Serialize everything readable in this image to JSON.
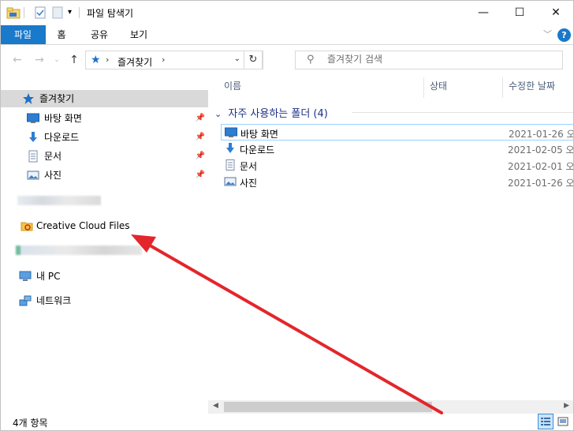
{
  "window": {
    "title": "파일 탐색기",
    "minimize": "—",
    "maximize": "☐",
    "close": "✕"
  },
  "ribbon": {
    "tabs": [
      "파일",
      "홈",
      "공유",
      "보기"
    ],
    "help": "?"
  },
  "address": {
    "path": "즐겨찾기",
    "search_placeholder": "즐겨찾기 검색"
  },
  "nav": {
    "quick_access": "즐겨찾기",
    "pinned": [
      {
        "label": "바탕 화면",
        "icon": "desktop-icon"
      },
      {
        "label": "다운로드",
        "icon": "downloads-icon"
      },
      {
        "label": "문서",
        "icon": "documents-icon"
      },
      {
        "label": "사진",
        "icon": "pictures-icon"
      }
    ],
    "creative_cloud": "Creative Cloud Files",
    "this_pc": "내 PC",
    "network": "네트워크"
  },
  "columns": {
    "name": "이름",
    "status": "상태",
    "modified": "수정한 날짜"
  },
  "group": {
    "label": "자주 사용하는 폴더 (4)"
  },
  "files": [
    {
      "name": "바탕 화면",
      "date": "2021-01-26 오",
      "icon": "desktop-icon"
    },
    {
      "name": "다운로드",
      "date": "2021-02-05 오",
      "icon": "downloads-icon"
    },
    {
      "name": "문서",
      "date": "2021-02-01 오",
      "icon": "documents-icon"
    },
    {
      "name": "사진",
      "date": "2021-01-26 오",
      "icon": "pictures-icon"
    }
  ],
  "status": {
    "count": "4개 항목"
  },
  "colors": {
    "accent": "#1979ca",
    "annotation_arrow": "#e3262b"
  }
}
